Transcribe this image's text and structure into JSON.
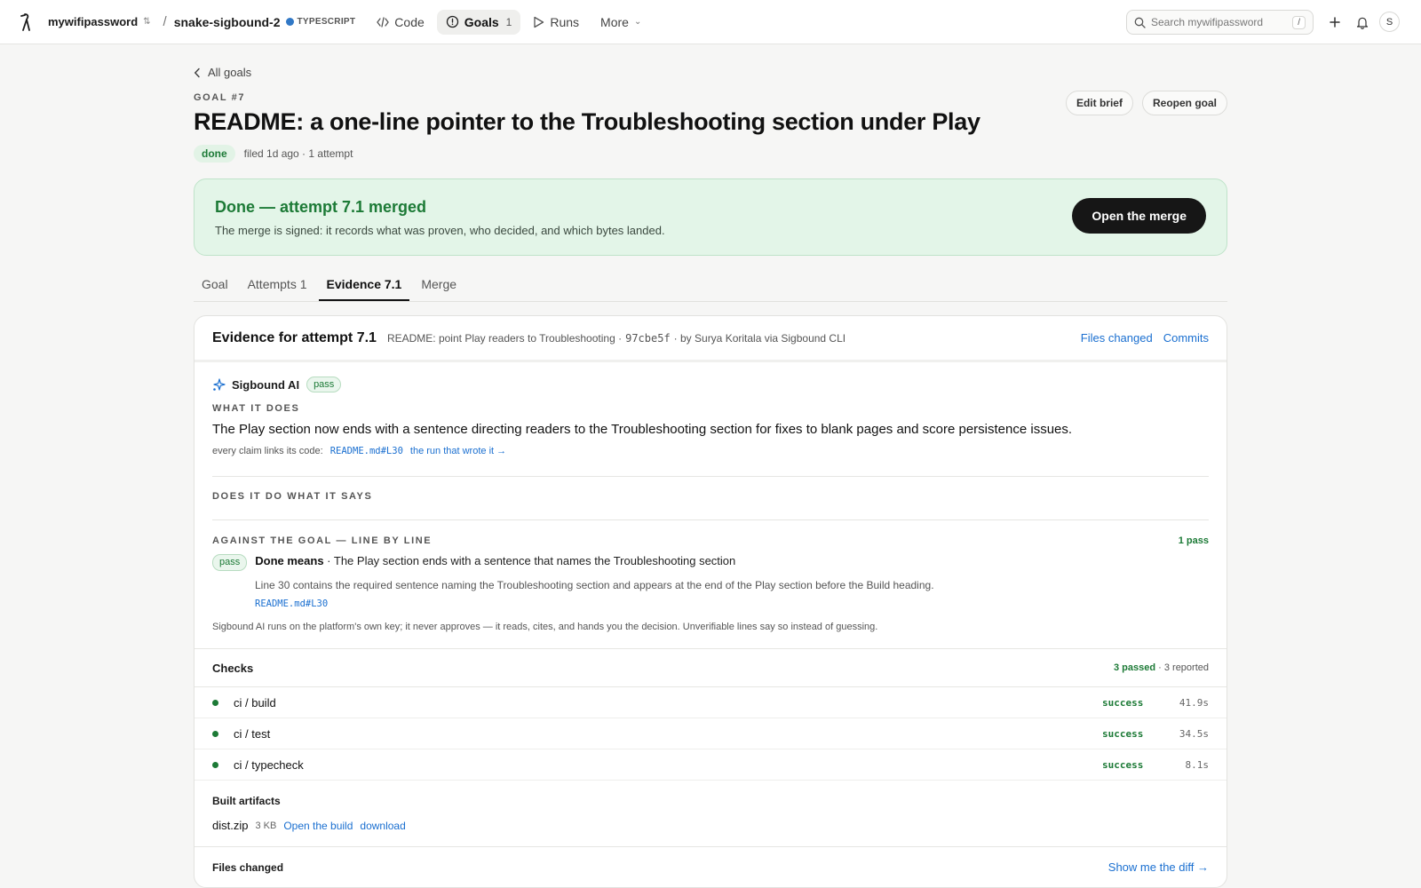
{
  "topbar": {
    "owner": "mywifipassword",
    "repo": "snake-sigbound-2",
    "language": "TYPESCRIPT",
    "nav": {
      "code": "Code",
      "goals": "Goals",
      "goals_count": "1",
      "runs": "Runs",
      "more": "More"
    },
    "search_placeholder": "Search mywifipassword",
    "search_shortcut": "/",
    "avatar_initial": "S",
    "colors": {
      "language_dot": "#3178c6"
    }
  },
  "goal": {
    "back_label": "All goals",
    "number": "GOAL #7",
    "title": "README: a one-line pointer to the Troubleshooting section under Play",
    "status": "done",
    "meta": "filed 1d ago · 1 attempt",
    "edit_brief": "Edit brief",
    "reopen": "Reopen goal"
  },
  "banner": {
    "title": "Done — attempt 7.1 merged",
    "subtitle": "The merge is signed: it records what was proven, who decided, and which bytes landed.",
    "button": "Open the merge",
    "colors": {
      "bg": "#e3f5e8",
      "accent": "#1c7a36"
    }
  },
  "tabs": [
    {
      "label": "Goal"
    },
    {
      "label": "Attempts 1"
    },
    {
      "label": "Evidence 7.1"
    },
    {
      "label": "Merge"
    }
  ],
  "evidence": {
    "title": "Evidence for attempt 7.1",
    "commit_message": "README: point Play readers to Troubleshooting ·",
    "commit_sha": "97cbe5f",
    "commit_author": "· by Surya Koritala via Sigbound CLI",
    "links": {
      "files_changed": "Files changed",
      "commits": "Commits"
    },
    "ai": {
      "name": "Sigbound AI",
      "badge": "pass",
      "what_label": "WHAT IT DOES",
      "what_text": "The Play section now ends with a sentence directing readers to the Troubleshooting section for fixes to blank pages and score persistence issues.",
      "claim_prefix": "every claim links its code:",
      "claim_ref": "README.md#L30",
      "claim_run": "the run that wrote it →",
      "does_label": "DOES IT DO WHAT IT SAYS",
      "against_label": "AGAINST THE GOAL — LINE BY LINE",
      "against_summary": "1 pass",
      "line_badge": "pass",
      "line_title": "Done means",
      "line_text": " · The Play section ends with a sentence that names the Troubleshooting section",
      "line_detail": "Line 30 contains the required sentence naming the Troubleshooting section and appears at the end of the Play section before the Build heading.",
      "line_ref": "README.md#L30",
      "disclaimer": "Sigbound AI runs on the platform's own key; it never approves — it reads, cites, and hands you the decision. Unverifiable lines say so instead of guessing."
    },
    "checks": {
      "title": "Checks",
      "passed": "3 passed",
      "reported": " · 3 reported",
      "rows": [
        {
          "name": "ci / build",
          "status": "success",
          "time": "41.9s"
        },
        {
          "name": "ci / test",
          "status": "success",
          "time": "34.5s"
        },
        {
          "name": "ci / typecheck",
          "status": "success",
          "time": "8.1s"
        }
      ]
    },
    "artifacts": {
      "title": "Built artifacts",
      "name": "dist.zip",
      "size": "3 KB",
      "open": "Open the build",
      "download": "download"
    },
    "files": {
      "title": "Files changed",
      "link": "Show me the diff →"
    }
  }
}
